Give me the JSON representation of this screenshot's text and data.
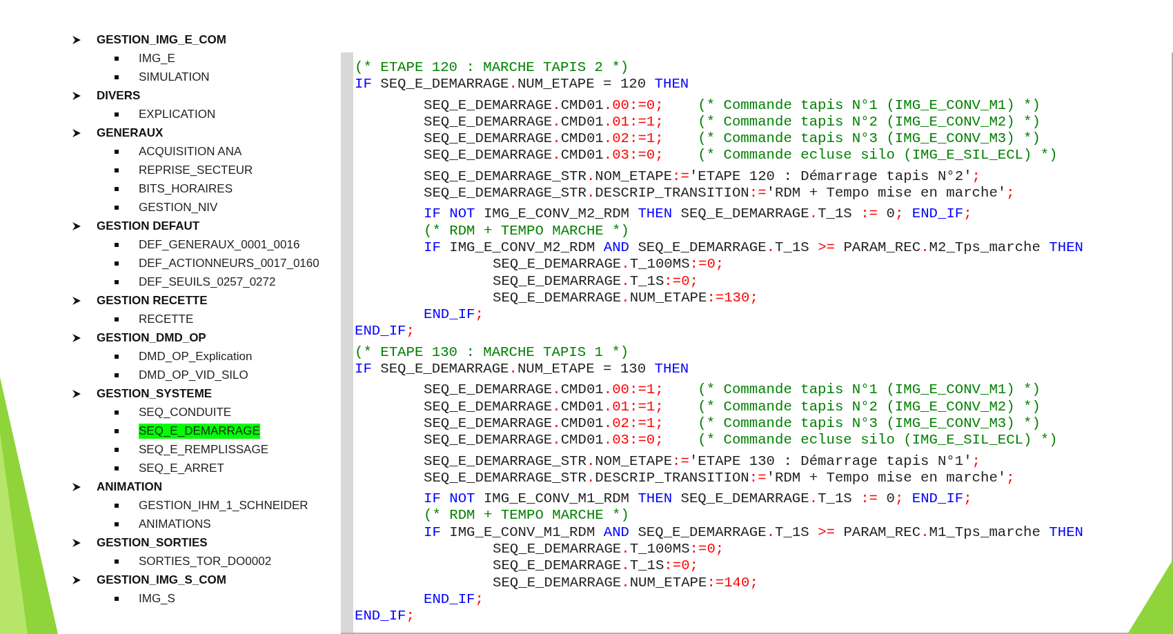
{
  "outline": [
    {
      "label": "GESTION_IMG_E_COM",
      "children": [
        {
          "label": "IMG_E",
          "selected": false
        },
        {
          "label": "SIMULATION",
          "selected": false
        }
      ]
    },
    {
      "label": "DIVERS",
      "children": [
        {
          "label": "EXPLICATION",
          "selected": false
        }
      ]
    },
    {
      "label": "GENERAUX",
      "children": [
        {
          "label": "ACQUISITION ANA",
          "selected": false
        },
        {
          "label": "REPRISE_SECTEUR",
          "selected": false
        },
        {
          "label": "BITS_HORAIRES",
          "selected": false
        },
        {
          "label": "GESTION_NIV",
          "selected": false
        }
      ]
    },
    {
      "label": "GESTION DEFAUT",
      "children": [
        {
          "label": "DEF_GENERAUX_0001_0016",
          "selected": false
        },
        {
          "label": "DEF_ACTIONNEURS_0017_0160",
          "selected": false
        },
        {
          "label": "DEF_SEUILS_0257_0272",
          "selected": false
        }
      ]
    },
    {
      "label": "GESTION RECETTE",
      "children": [
        {
          "label": "RECETTE",
          "selected": false
        }
      ]
    },
    {
      "label": "GESTION_DMD_OP",
      "children": [
        {
          "label": "DMD_OP_Explication",
          "selected": false
        },
        {
          "label": "DMD_OP_VID_SILO",
          "selected": false
        }
      ]
    },
    {
      "label": "GESTION_SYSTEME",
      "children": [
        {
          "label": "SEQ_CONDUITE",
          "selected": false
        },
        {
          "label": "SEQ_E_DEMARRAGE",
          "selected": true
        },
        {
          "label": "SEQ_E_REMPLISSAGE",
          "selected": false
        },
        {
          "label": "SEQ_E_ARRET",
          "selected": false
        }
      ]
    },
    {
      "label": "ANIMATION",
      "children": [
        {
          "label": "GESTION_IHM_1_SCHNEIDER",
          "selected": false
        },
        {
          "label": "ANIMATIONS",
          "selected": false
        }
      ]
    },
    {
      "label": "GESTION_SORTIES",
      "children": [
        {
          "label": "SORTIES_TOR_DO0002",
          "selected": false
        }
      ]
    },
    {
      "label": "GESTION_IMG_S_COM",
      "children": [
        {
          "label": "IMG_S",
          "selected": false
        }
      ]
    }
  ],
  "code_blocks": [
    {
      "lines": [
        [
          {
            "kind": "comment",
            "text": "(* ETAPE 120 : MARCHE TAPIS 2 *)"
          }
        ],
        [
          {
            "kind": "keyword",
            "text": "IF"
          },
          {
            "kind": "ident",
            "text": " SEQ_E_DEMARRAGE"
          },
          {
            "kind": "op",
            "text": "."
          },
          {
            "kind": "ident",
            "text": "NUM_ETAPE = 120 "
          },
          {
            "kind": "keyword",
            "text": "THEN"
          }
        ]
      ]
    },
    {
      "lines": [
        [
          {
            "kind": "ident",
            "text": "\tSEQ_E_DEMARRAGE"
          },
          {
            "kind": "op",
            "text": "."
          },
          {
            "kind": "ident",
            "text": "CMD01"
          },
          {
            "kind": "op",
            "text": ".00:=0;"
          },
          {
            "kind": "comment",
            "text": "    (* Commande tapis N°1 (IMG_E_CONV_M1) *)"
          }
        ],
        [
          {
            "kind": "ident",
            "text": "\tSEQ_E_DEMARRAGE"
          },
          {
            "kind": "op",
            "text": "."
          },
          {
            "kind": "ident",
            "text": "CMD01"
          },
          {
            "kind": "op",
            "text": ".01:=1;"
          },
          {
            "kind": "comment",
            "text": "    (* Commande tapis N°2 (IMG_E_CONV_M2) *)"
          }
        ],
        [
          {
            "kind": "ident",
            "text": "\tSEQ_E_DEMARRAGE"
          },
          {
            "kind": "op",
            "text": "."
          },
          {
            "kind": "ident",
            "text": "CMD01"
          },
          {
            "kind": "op",
            "text": ".02:=1;"
          },
          {
            "kind": "comment",
            "text": "    (* Commande tapis N°3 (IMG_E_CONV_M3) *)"
          }
        ],
        [
          {
            "kind": "ident",
            "text": "\tSEQ_E_DEMARRAGE"
          },
          {
            "kind": "op",
            "text": "."
          },
          {
            "kind": "ident",
            "text": "CMD01"
          },
          {
            "kind": "op",
            "text": ".03:=0;"
          },
          {
            "kind": "comment",
            "text": "    (* Commande ecluse silo (IMG_E_SIL_ECL) *)"
          }
        ]
      ]
    },
    {
      "lines": [
        [
          {
            "kind": "ident",
            "text": "\tSEQ_E_DEMARRAGE_STR"
          },
          {
            "kind": "op",
            "text": "."
          },
          {
            "kind": "ident",
            "text": "NOM_ETAPE"
          },
          {
            "kind": "op",
            "text": ":="
          },
          {
            "kind": "ident",
            "text": "'ETAPE 120 : Démarrage tapis N°2'"
          },
          {
            "kind": "op",
            "text": ";"
          }
        ],
        [
          {
            "kind": "ident",
            "text": "\tSEQ_E_DEMARRAGE_STR"
          },
          {
            "kind": "op",
            "text": "."
          },
          {
            "kind": "ident",
            "text": "DESCRIP_TRANSITION"
          },
          {
            "kind": "op",
            "text": ":="
          },
          {
            "kind": "ident",
            "text": "'RDM + Tempo mise en marche'"
          },
          {
            "kind": "op",
            "text": ";"
          }
        ]
      ]
    },
    {
      "lines": [
        [
          {
            "kind": "keyword",
            "text": "\tIF NOT"
          },
          {
            "kind": "ident",
            "text": " IMG_E_CONV_M2_RDM "
          },
          {
            "kind": "keyword",
            "text": "THEN"
          },
          {
            "kind": "ident",
            "text": " SEQ_E_DEMARRAGE"
          },
          {
            "kind": "op",
            "text": "."
          },
          {
            "kind": "ident",
            "text": "T_1S "
          },
          {
            "kind": "op",
            "text": ":="
          },
          {
            "kind": "ident",
            "text": " 0"
          },
          {
            "kind": "op",
            "text": ";"
          },
          {
            "kind": "keyword",
            "text": " END_IF"
          },
          {
            "kind": "op",
            "text": ";"
          }
        ],
        [
          {
            "kind": "comment",
            "text": "\t(* RDM + TEMPO MARCHE *)"
          }
        ],
        [
          {
            "kind": "keyword",
            "text": "\tIF"
          },
          {
            "kind": "ident",
            "text": " IMG_E_CONV_M2_RDM "
          },
          {
            "kind": "keyword",
            "text": "AND"
          },
          {
            "kind": "ident",
            "text": " SEQ_E_DEMARRAGE"
          },
          {
            "kind": "op",
            "text": "."
          },
          {
            "kind": "ident",
            "text": "T_1S "
          },
          {
            "kind": "op",
            "text": ">="
          },
          {
            "kind": "ident",
            "text": " PARAM_REC"
          },
          {
            "kind": "op",
            "text": "."
          },
          {
            "kind": "ident",
            "text": "M2_Tps_marche "
          },
          {
            "kind": "keyword",
            "text": "THEN"
          }
        ],
        [
          {
            "kind": "ident",
            "text": "\t\tSEQ_E_DEMARRAGE"
          },
          {
            "kind": "op",
            "text": "."
          },
          {
            "kind": "ident",
            "text": "T_100MS"
          },
          {
            "kind": "op",
            "text": ":=0;"
          }
        ],
        [
          {
            "kind": "ident",
            "text": "\t\tSEQ_E_DEMARRAGE"
          },
          {
            "kind": "op",
            "text": "."
          },
          {
            "kind": "ident",
            "text": "T_1S"
          },
          {
            "kind": "op",
            "text": ":=0;"
          }
        ],
        [
          {
            "kind": "ident",
            "text": "\t\tSEQ_E_DEMARRAGE"
          },
          {
            "kind": "op",
            "text": "."
          },
          {
            "kind": "ident",
            "text": "NUM_ETAPE"
          },
          {
            "kind": "op",
            "text": ":=130;"
          }
        ],
        [
          {
            "kind": "keyword",
            "text": "\tEND_IF"
          },
          {
            "kind": "op",
            "text": ";"
          }
        ],
        [
          {
            "kind": "keyword",
            "text": "END_IF"
          },
          {
            "kind": "op",
            "text": ";"
          }
        ]
      ]
    },
    {
      "lines": [
        [
          {
            "kind": "comment",
            "text": "(* ETAPE 130 : MARCHE TAPIS 1 *)"
          }
        ],
        [
          {
            "kind": "keyword",
            "text": "IF"
          },
          {
            "kind": "ident",
            "text": " SEQ_E_DEMARRAGE"
          },
          {
            "kind": "op",
            "text": "."
          },
          {
            "kind": "ident",
            "text": "NUM_ETAPE = 130 "
          },
          {
            "kind": "keyword",
            "text": "THEN"
          }
        ]
      ]
    },
    {
      "lines": [
        [
          {
            "kind": "ident",
            "text": "\tSEQ_E_DEMARRAGE"
          },
          {
            "kind": "op",
            "text": "."
          },
          {
            "kind": "ident",
            "text": "CMD01"
          },
          {
            "kind": "op",
            "text": ".00:=1;"
          },
          {
            "kind": "comment",
            "text": "    (* Commande tapis N°1 (IMG_E_CONV_M1) *)"
          }
        ],
        [
          {
            "kind": "ident",
            "text": "\tSEQ_E_DEMARRAGE"
          },
          {
            "kind": "op",
            "text": "."
          },
          {
            "kind": "ident",
            "text": "CMD01"
          },
          {
            "kind": "op",
            "text": ".01:=1;"
          },
          {
            "kind": "comment",
            "text": "    (* Commande tapis N°2 (IMG_E_CONV_M2) *)"
          }
        ],
        [
          {
            "kind": "ident",
            "text": "\tSEQ_E_DEMARRAGE"
          },
          {
            "kind": "op",
            "text": "."
          },
          {
            "kind": "ident",
            "text": "CMD01"
          },
          {
            "kind": "op",
            "text": ".02:=1;"
          },
          {
            "kind": "comment",
            "text": "    (* Commande tapis N°3 (IMG_E_CONV_M3) *)"
          }
        ],
        [
          {
            "kind": "ident",
            "text": "\tSEQ_E_DEMARRAGE"
          },
          {
            "kind": "op",
            "text": "."
          },
          {
            "kind": "ident",
            "text": "CMD01"
          },
          {
            "kind": "op",
            "text": ".03:=0;"
          },
          {
            "kind": "comment",
            "text": "    (* Commande ecluse silo (IMG_E_SIL_ECL) *)"
          }
        ]
      ]
    },
    {
      "lines": [
        [
          {
            "kind": "ident",
            "text": "\tSEQ_E_DEMARRAGE_STR"
          },
          {
            "kind": "op",
            "text": "."
          },
          {
            "kind": "ident",
            "text": "NOM_ETAPE"
          },
          {
            "kind": "op",
            "text": ":="
          },
          {
            "kind": "ident",
            "text": "'ETAPE 130 : Démarrage tapis N°1'"
          },
          {
            "kind": "op",
            "text": ";"
          }
        ],
        [
          {
            "kind": "ident",
            "text": "\tSEQ_E_DEMARRAGE_STR"
          },
          {
            "kind": "op",
            "text": "."
          },
          {
            "kind": "ident",
            "text": "DESCRIP_TRANSITION"
          },
          {
            "kind": "op",
            "text": ":="
          },
          {
            "kind": "ident",
            "text": "'RDM + Tempo mise en marche'"
          },
          {
            "kind": "op",
            "text": ";"
          }
        ]
      ]
    },
    {
      "lines": [
        [
          {
            "kind": "keyword",
            "text": "\tIF NOT"
          },
          {
            "kind": "ident",
            "text": " IMG_E_CONV_M1_RDM "
          },
          {
            "kind": "keyword",
            "text": "THEN"
          },
          {
            "kind": "ident",
            "text": " SEQ_E_DEMARRAGE"
          },
          {
            "kind": "op",
            "text": "."
          },
          {
            "kind": "ident",
            "text": "T_1S "
          },
          {
            "kind": "op",
            "text": ":="
          },
          {
            "kind": "ident",
            "text": " 0"
          },
          {
            "kind": "op",
            "text": ";"
          },
          {
            "kind": "keyword",
            "text": " END_IF"
          },
          {
            "kind": "op",
            "text": ";"
          }
        ],
        [
          {
            "kind": "comment",
            "text": "\t(* RDM + TEMPO MARCHE *)"
          }
        ],
        [
          {
            "kind": "keyword",
            "text": "\tIF"
          },
          {
            "kind": "ident",
            "text": " IMG_E_CONV_M1_RDM "
          },
          {
            "kind": "keyword",
            "text": "AND"
          },
          {
            "kind": "ident",
            "text": " SEQ_E_DEMARRAGE"
          },
          {
            "kind": "op",
            "text": "."
          },
          {
            "kind": "ident",
            "text": "T_1S "
          },
          {
            "kind": "op",
            "text": ">="
          },
          {
            "kind": "ident",
            "text": " PARAM_REC"
          },
          {
            "kind": "op",
            "text": "."
          },
          {
            "kind": "ident",
            "text": "M1_Tps_marche "
          },
          {
            "kind": "keyword",
            "text": "THEN"
          }
        ],
        [
          {
            "kind": "ident",
            "text": "\t\tSEQ_E_DEMARRAGE"
          },
          {
            "kind": "op",
            "text": "."
          },
          {
            "kind": "ident",
            "text": "T_100MS"
          },
          {
            "kind": "op",
            "text": ":=0;"
          }
        ],
        [
          {
            "kind": "ident",
            "text": "\t\tSEQ_E_DEMARRAGE"
          },
          {
            "kind": "op",
            "text": "."
          },
          {
            "kind": "ident",
            "text": "T_1S"
          },
          {
            "kind": "op",
            "text": ":=0;"
          }
        ],
        [
          {
            "kind": "ident",
            "text": "\t\tSEQ_E_DEMARRAGE"
          },
          {
            "kind": "op",
            "text": "."
          },
          {
            "kind": "ident",
            "text": "NUM_ETAPE"
          },
          {
            "kind": "op",
            "text": ":=140;"
          }
        ],
        [
          {
            "kind": "keyword",
            "text": "\tEND_IF"
          },
          {
            "kind": "op",
            "text": ";"
          }
        ],
        [
          {
            "kind": "keyword",
            "text": "END_IF"
          },
          {
            "kind": "op",
            "text": ";"
          }
        ]
      ]
    }
  ]
}
